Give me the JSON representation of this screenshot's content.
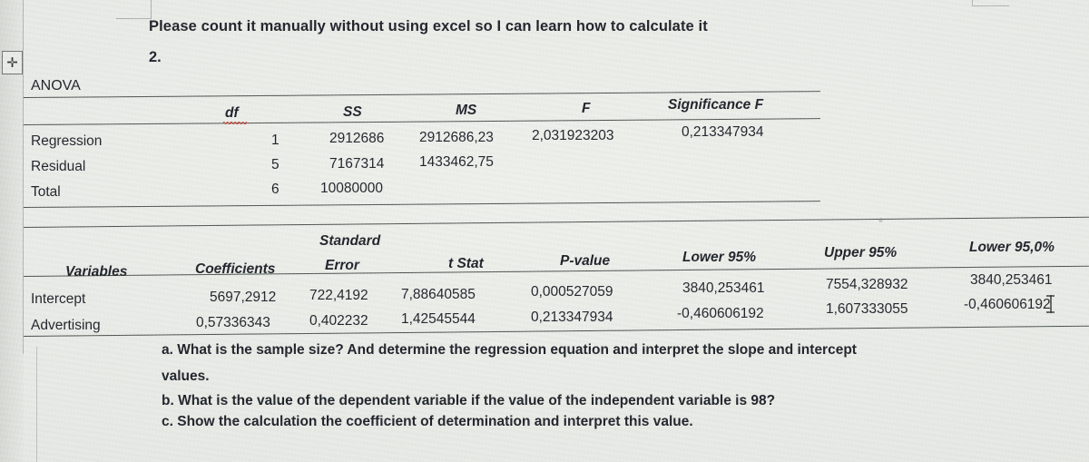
{
  "document": {
    "prompt": "Please count it manually without using excel so I can learn how to calculate it",
    "question_number": "2.",
    "anova_label": "ANOVA"
  },
  "icons": {
    "move_handle": "move-handle-icon",
    "move_handle_glyph": "✛"
  },
  "anova_table": {
    "columns": [
      "",
      "df",
      "SS",
      "MS",
      "F",
      "Significance F"
    ],
    "rows": [
      {
        "label": "Regression",
        "df": "1",
        "ss": "2912686",
        "ms": "2912686,23",
        "f": "2,031923203",
        "significance_f": "0,213347934"
      },
      {
        "label": "Residual",
        "df": "5",
        "ss": "7167314",
        "ms": "1433462,75",
        "f": "",
        "significance_f": ""
      },
      {
        "label": "Total",
        "df": "6",
        "ss": "10080000",
        "ms": "",
        "f": "",
        "significance_f": ""
      }
    ]
  },
  "coefficients_table": {
    "columns": [
      "Variables",
      "Coefficients",
      "Standard",
      "Error",
      "t Stat",
      "P-value",
      "Lower 95%",
      "Upper 95%",
      "Lower 95,0%"
    ],
    "rows": [
      {
        "variable": "Intercept",
        "coefficient": "5697,2912",
        "standard_error": "722,4192",
        "t_stat": "7,88640585",
        "p_value": "0,000527059",
        "lower_95": "3840,253461",
        "upper_95": "7554,328932",
        "lower_95_0": "3840,253461"
      },
      {
        "variable": "Advertising",
        "coefficient": "0,57336343",
        "standard_error": "0,402232",
        "t_stat": "1,42545544",
        "p_value": "0,213347934",
        "lower_95": "-0,460606192",
        "upper_95": "1,607333055",
        "lower_95_0": "-0,460606192"
      }
    ]
  },
  "questions": [
    "a. What is the sample size? And determine the regression equation and interpret the slope and intercept",
    "values.",
    "b. What is the value of the dependent variable if the value of the independent variable is 98?",
    "c. Show the calculation the coefficient of determination and interpret this value."
  ],
  "questions_parts": {
    "a_line1": "a. What is the sample size? And determine the regression equation and interpret the slope and intercept",
    "a_line2": "values.",
    "b_line": "b. What is the value of the dependent variable if the value of the independent variable is 98?",
    "c_line": "c. Show the calculation the coefficient of determination and interpret this value."
  },
  "colors": {
    "text": "#1c2128",
    "rule": "#4a524d",
    "background": "#e8eae6",
    "spellcheck": "#d03b2e"
  }
}
